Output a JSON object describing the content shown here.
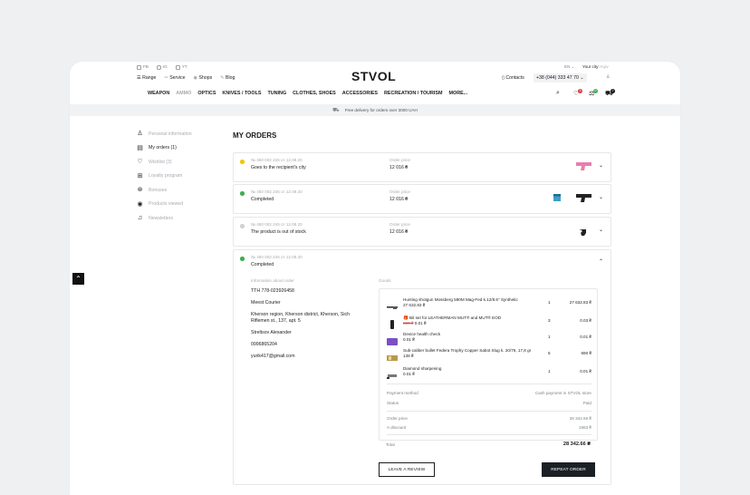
{
  "header": {
    "social": [
      "FB",
      "IG",
      "YT"
    ],
    "links": [
      "Range",
      "Service",
      "Shops",
      "Blog"
    ],
    "logo": "STVOL",
    "contacts_label": "Contacts",
    "phone": "+38 (044) 333 47 70",
    "lang": "EN",
    "city_label": "Your city:",
    "city_value": "Kyiv",
    "nav": [
      "WEAPON",
      "AMMO",
      "OPTICS",
      "KNIVES / TOOLS",
      "TUNING",
      "CLOTHES, SHOES",
      "ACCESSORIES",
      "RECREATION / TOURISM",
      "MORE..."
    ],
    "badges": {
      "wishlist": "3",
      "compare": "0",
      "cart": "2"
    },
    "banner": "Free delivery for orders over 3000 UAH"
  },
  "sidebar": {
    "items": [
      {
        "label": "Personal information",
        "icon": "user-icon",
        "active": false
      },
      {
        "label": "My orders (1)",
        "icon": "orders-icon",
        "active": true
      },
      {
        "label": "Wishlist (3)",
        "icon": "heart-icon",
        "active": false
      },
      {
        "label": "Loyalty program",
        "icon": "gift-icon",
        "active": false
      },
      {
        "label": "Bonuses",
        "icon": "bonus-icon",
        "active": false
      },
      {
        "label": "Products viewed",
        "icon": "eye-icon",
        "active": false
      },
      {
        "label": "Newsletters",
        "icon": "bell-icon",
        "active": false
      }
    ]
  },
  "page_title": "MY ORDERS",
  "orders": [
    {
      "meta": "№ 450 002 245 от 12.08.20",
      "status": "Goes to the recipient's city",
      "status_color": "#f2c500",
      "price_label": "Order price",
      "price": "12 016 ₴"
    },
    {
      "meta": "№ 450 002 245 от 12.08.20",
      "status": "Completed",
      "status_color": "#3fae4e",
      "price_label": "Order price",
      "price": "12 016 ₴"
    },
    {
      "meta": "№ 450 002 245 от 12.08.20",
      "status": "The product is out of stock",
      "status_color": "#cfd2d6",
      "price_label": "Order price",
      "price": "12 016 ₴"
    }
  ],
  "expanded": {
    "meta": "№ 450 002 245 от 12.08.20",
    "status": "Completed",
    "status_color": "#3fae4e",
    "info_title": "Information about order",
    "info_lines": [
      "TTH 778-023926458",
      "Meest Courier",
      "Kherson region, Kherson district, Kherson, Sich Riflemen st., 137, apt. 5",
      "Streltsov Alexander",
      "0996865204",
      "yurik417@gmail.com"
    ],
    "goods_title": "Goods",
    "goods": [
      {
        "name": "Hunting shotgun Mossberg 590M Mag-Fed k.12/8.5\" Synthetic",
        "price": "27 632.83 ₴",
        "old_price": "",
        "qty": "1",
        "sum": "27 632.83 ₴"
      },
      {
        "name": "🎁 Bit set for LEATHERMAN MUT® and MUT® EOD",
        "price": "0.01 ₴",
        "old_price": "800 ₴",
        "qty": "3",
        "sum": "0.03 ₴"
      },
      {
        "name": "Device health check",
        "price": "0.01 ₴",
        "old_price": "",
        "qty": "1",
        "sum": "0.01 ₴"
      },
      {
        "name": "Sub-caliber bullet Federa Trophy Copper Sabot Slug k. 20/76, 17,8 gr",
        "price": "138 ₴",
        "old_price": "",
        "qty": "5",
        "sum": "690 ₴"
      },
      {
        "name": "Diamond sharpening",
        "price": "0.01 ₴",
        "old_price": "",
        "qty": "1",
        "sum": "0.01 ₴"
      }
    ],
    "payment_label": "Payment method",
    "payment_value": "Cash payment in STVOL store",
    "status_label": "Status",
    "status_value": "Paid",
    "order_price_label": "Order price",
    "order_price_value": "28 342.66 ₴",
    "discount_label": "A discount",
    "discount_value": "1983 ₴",
    "total_label": "Total",
    "total_value": "28 342.66 ₴",
    "review_button": "LEAVE A REVIEW",
    "repeat_button": "REPEAT ORDER"
  }
}
